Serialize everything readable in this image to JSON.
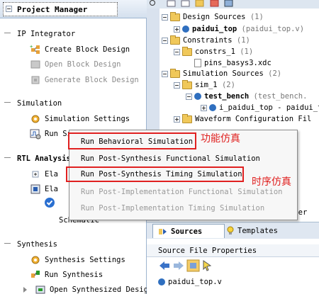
{
  "window": {
    "title": "Project Manager"
  },
  "navigator": {
    "sections": [
      {
        "label": "IP Integrator"
      },
      {
        "label": "Simulation"
      },
      {
        "label": "RTL Analysis"
      },
      {
        "label": "Synthesis"
      }
    ],
    "ip": [
      "Create Block Design",
      "Open Block Design",
      "Generate Block Design"
    ],
    "sim": [
      "Simulation Settings",
      "Run Simulation"
    ],
    "rtl_partial": [
      "Ela",
      "Ela"
    ],
    "rtl_schematic": "Schematic",
    "syn": [
      "Synthesis Settings",
      "Run Synthesis",
      "Open Synthesized Design"
    ]
  },
  "sources": {
    "design": {
      "label": "Design Sources",
      "count": "(1)"
    },
    "paidui": {
      "name": "paidui_top",
      "file": "(paidui_top.v)"
    },
    "constraints": {
      "label": "Constraints",
      "count": "(1)"
    },
    "constrs": {
      "label": "constrs_1",
      "count": "(1)"
    },
    "xdc": "pins_basys3.xdc",
    "simsrc": {
      "label": "Simulation Sources",
      "count": "(2)"
    },
    "sim1": {
      "label": "sim_1",
      "count": "(2)"
    },
    "tb": {
      "name": "test_bench",
      "file": "(test_bench."
    },
    "inst": "i_paidui_top - paidui_t",
    "wcfg": "Waveform Configuration Fil"
  },
  "tabs": {
    "sources": "Sources",
    "templates": "Templates",
    "order": "rder"
  },
  "props": {
    "title": "Source File Properties",
    "file": "paidui_top.v"
  },
  "menu": {
    "items": [
      "Run Behavioral Simulation",
      "Run Post-Synthesis Functional Simulation",
      "Run Post-Synthesis Timing Simulation",
      "Run Post-Implementation Functional Simulation",
      "Run Post-Implementation Timing Simulation"
    ],
    "annot_behav": "功能仿真",
    "annot_timing": "时序仿真"
  },
  "colors": {
    "highlight": "#e02020",
    "selection_bg": "#ffffff",
    "panel_bg": "#dde6f0"
  }
}
